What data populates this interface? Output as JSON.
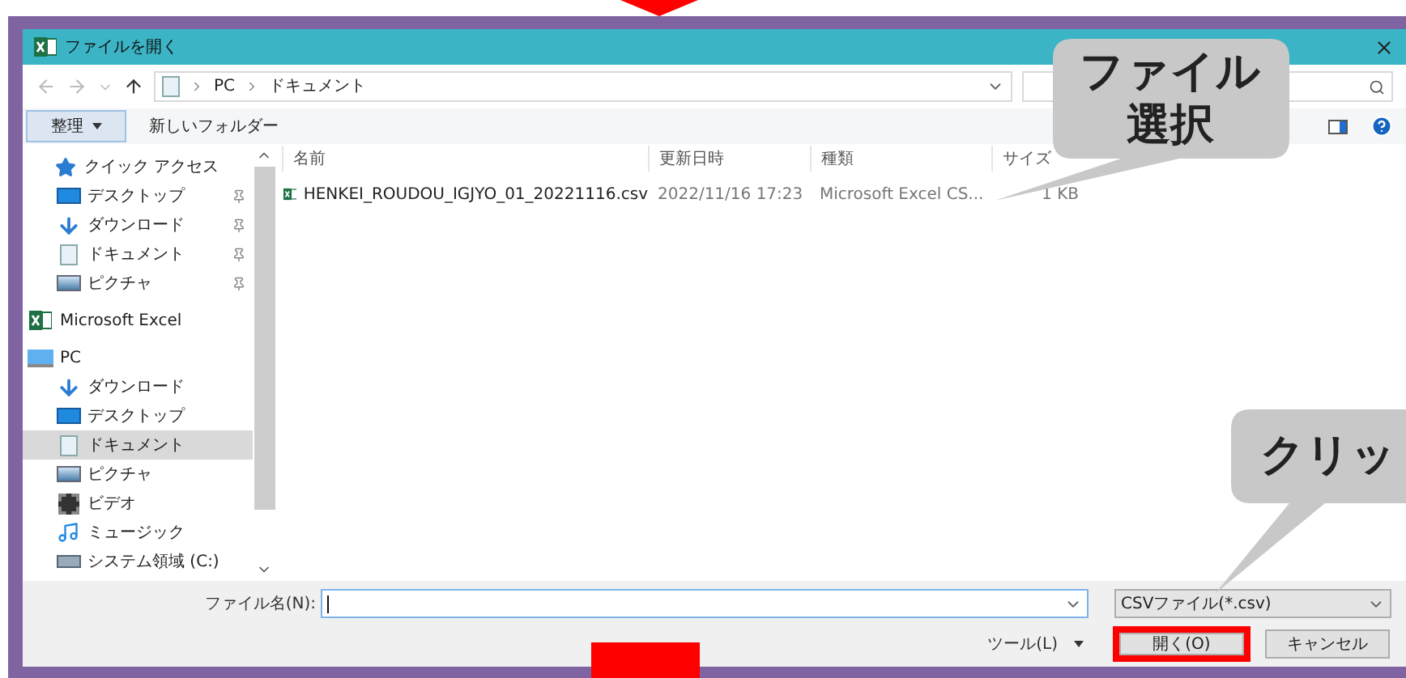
{
  "dialog": {
    "title": "ファイルを開く"
  },
  "address": {
    "path": [
      "PC",
      "ドキュメント"
    ]
  },
  "toolbar": {
    "organize": "整理",
    "new_folder": "新しいフォルダー"
  },
  "sidebar": [
    {
      "label": "クイック アクセス",
      "kind": "star",
      "selected": false,
      "children": [
        {
          "label": "デスクトップ",
          "kind": "desktop",
          "pinned": true,
          "selected": false
        },
        {
          "label": "ダウンロード",
          "kind": "download",
          "pinned": true,
          "selected": false
        },
        {
          "label": "ドキュメント",
          "kind": "document",
          "pinned": true,
          "selected": false
        },
        {
          "label": "ピクチャ",
          "kind": "picture",
          "pinned": true,
          "selected": false
        }
      ]
    },
    {
      "label": "Microsoft Excel",
      "kind": "excel",
      "selected": false
    },
    {
      "label": "PC",
      "kind": "pc",
      "selected": false,
      "children": [
        {
          "label": "ダウンロード",
          "kind": "download",
          "pinned": false,
          "selected": false
        },
        {
          "label": "デスクトップ",
          "kind": "desktop",
          "pinned": false,
          "selected": false
        },
        {
          "label": "ドキュメント",
          "kind": "document",
          "pinned": false,
          "selected": true
        },
        {
          "label": "ピクチャ",
          "kind": "picture",
          "pinned": false,
          "selected": false
        },
        {
          "label": "ビデオ",
          "kind": "video",
          "pinned": false,
          "selected": false
        },
        {
          "label": "ミュージック",
          "kind": "music",
          "pinned": false,
          "selected": false
        },
        {
          "label": "システム領域 (C:)",
          "kind": "drive",
          "pinned": false,
          "selected": false
        }
      ]
    }
  ],
  "columns": [
    "名前",
    "更新日時",
    "種類",
    "サイズ"
  ],
  "files": [
    {
      "name": "HENKEI_ROUDOU_IGJYO_01_20221116.csv",
      "modified": "2022/11/16 17:23",
      "type": "Microsoft Excel CS...",
      "size": "1 KB"
    }
  ],
  "footer": {
    "filename_label": "ファイル名(N):",
    "filter": "CSVファイル(*.csv)",
    "tools": "ツール(L)",
    "open": {
      "label": "開く(O)",
      "highlighted": true
    },
    "cancel": "キャンセル"
  },
  "callouts": [
    {
      "lines": [
        "ファイル",
        "選択"
      ]
    },
    {
      "lines": [
        "クリッ"
      ]
    }
  ]
}
